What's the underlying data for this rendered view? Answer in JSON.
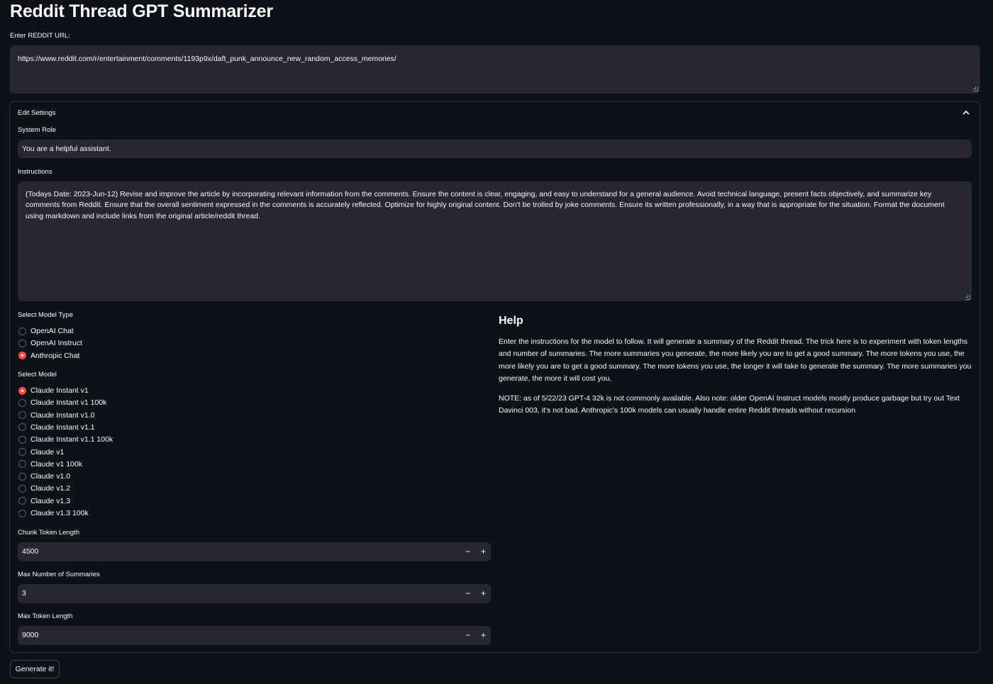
{
  "title": "Reddit Thread GPT Summarizer",
  "url_input": {
    "label": "Enter REDDIT URL:",
    "value": "https://www.reddit.com/r/entertainment/comments/1193p9x/daft_punk_announce_new_random_access_memories/"
  },
  "settings": {
    "label": "Edit Settings",
    "expanded": true,
    "system_role": {
      "label": "System Role",
      "value": "You are a helpful assistant."
    },
    "instructions": {
      "label": "Instructions",
      "value": "(Todays Date: 2023-Jun-12) Revise and improve the article by incorporating relevant information from the comments. Ensure the content is clear, engaging, and easy to understand for a general audience. Avoid technical language, present facts objectively, and summarize key comments from Reddit. Ensure that the overall sentiment expressed in the comments is accurately reflected. Optimize for highly original content. Don't be trolled by joke comments. Ensure its written professionally, in a way that is appropriate for the situation. Format the document using markdown and include links from the original article/reddit thread."
    },
    "model_type": {
      "label": "Select Model Type",
      "options": [
        "OpenAI Chat",
        "OpenAI Instruct",
        "Anthropic Chat"
      ],
      "selected": "Anthropic Chat"
    },
    "model": {
      "label": "Select Model",
      "options": [
        "Claude Instant v1",
        "Claude Instant v1 100k",
        "Claude Instant v1.0",
        "Claude Instant v1.1",
        "Claude Instant v1.1 100k",
        "Claude v1",
        "Claude v1 100k",
        "Claude v1.0",
        "Claude v1.2",
        "Claude v1.3",
        "Claude v1.3 100k"
      ],
      "selected": "Claude Instant v1"
    },
    "chunk_token_length": {
      "label": "Chunk Token Length",
      "value": "4500"
    },
    "max_summaries": {
      "label": "Max Number of Summaries",
      "value": "3"
    },
    "max_token_length": {
      "label": "Max Token Length",
      "value": "9000"
    },
    "stepper_minus": "−",
    "stepper_plus": "+",
    "help": {
      "heading": "Help",
      "paragraph1": "Enter the instructions for the model to follow. It will generate a summary of the Reddit thread. The trick here is to experiment with token lengths and number of summaries. The more summaries you generate, the more likely you are to get a good summary. The more tokens you use, the more likely you are to get a good summary. The more tokens you use, the longer it will take to generate the summary. The more summaries you generate, the more it will cost you.",
      "paragraph2": "NOTE: as of 5/22/23 GPT-4 32k is not commonly available. Also note: older OpenAI Instruct models mostly produce garbage but try out Text Davinci 003, it's not bad. Anthropic's 100k models can usually handle entire Reddit threads without recursion"
    }
  },
  "generate_button": "Generate it!",
  "colors": {
    "background": "#0e1117",
    "input_bg": "#262730",
    "accent": "#ff4b4b",
    "text": "#fafafa"
  }
}
